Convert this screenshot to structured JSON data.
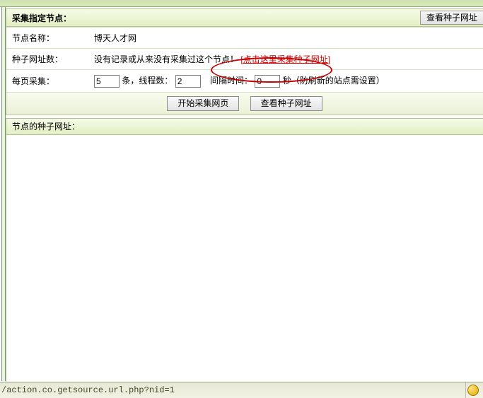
{
  "title": "采集指定节点：",
  "topButton": "查看种子网址",
  "labels": {
    "nodeName": "节点名称：",
    "seedCount": "种子网址数：",
    "perPage": "每页采集：",
    "tiao": "条，线程数：",
    "interval": "间隔时间：",
    "seconds": "秒（防刷新的站点需设置）"
  },
  "values": {
    "nodeNameValue": "博天人才网",
    "seedMsg": "没有记录或从来没有采集过这个节点！",
    "seedLink": "[点击这里采集种子网址]",
    "count": "5",
    "threads": "2",
    "interval": "0"
  },
  "buttons": {
    "start": "开始采集网页",
    "viewSeed": "查看种子网址"
  },
  "subhead": "节点的种子网址：",
  "status": "/action.co.getsource.url.php?nid=1"
}
